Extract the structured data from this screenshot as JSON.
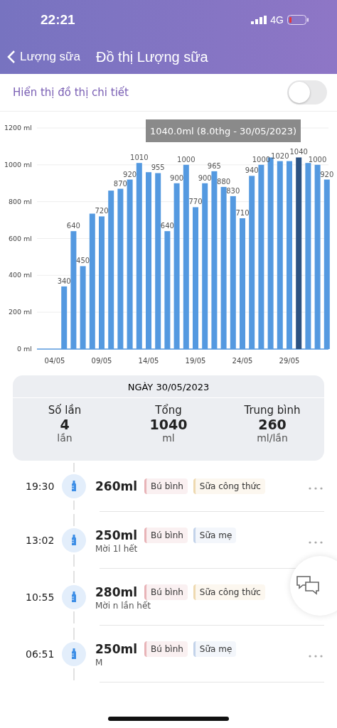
{
  "status_bar": {
    "time": "22:21",
    "network": "4G"
  },
  "header": {
    "back_label": "Lượng sữa",
    "title": "Đồ thị Lượng sữa"
  },
  "detail_toggle": {
    "label": "Hiển thị đồ thị chi tiết",
    "on": false
  },
  "chart_data": {
    "type": "bar",
    "categories": [
      null,
      "04/05",
      null,
      null,
      null,
      null,
      "09/05",
      null,
      null,
      null,
      null,
      "14/05",
      null,
      null,
      null,
      null,
      "19/05",
      null,
      null,
      null,
      null,
      "24/05",
      null,
      null,
      null,
      null,
      "29/05",
      null,
      null,
      null,
      null
    ],
    "stacked": true,
    "series": [
      {
        "color": "#5499e0",
        "values": [
          0,
          0,
          340,
          640,
          450,
          735,
          720,
          860,
          870,
          920,
          1010,
          960,
          955,
          640,
          900,
          1000,
          770,
          900,
          965,
          880,
          830,
          710,
          940,
          1000,
          1040,
          1020,
          1020,
          null,
          1010,
          1000,
          920
        ]
      },
      {
        "color": "#2c5282",
        "values": [
          null,
          null,
          null,
          null,
          null,
          null,
          null,
          null,
          null,
          null,
          null,
          null,
          null,
          null,
          null,
          null,
          null,
          null,
          null,
          null,
          null,
          null,
          null,
          null,
          null,
          null,
          null,
          1040,
          null,
          null,
          null
        ]
      }
    ],
    "ylim": [
      0,
      1200
    ],
    "yticks": [
      {
        "value": 0,
        "label": "0 ml"
      },
      {
        "value": 200,
        "label": "200 ml"
      },
      {
        "value": 400,
        "label": "400 ml"
      },
      {
        "value": 600,
        "label": "600 ml"
      },
      {
        "value": 800,
        "label": "800 ml"
      },
      {
        "value": 1000,
        "label": "1000 ml"
      },
      {
        "value": 1200,
        "label": "1200 ml"
      }
    ],
    "grid": true,
    "value_labels": [
      null,
      null,
      "340",
      "640",
      "450",
      null,
      "720",
      null,
      "870",
      "920",
      "1010",
      null,
      "955",
      "640",
      "900",
      "1000",
      "770",
      "900",
      "965",
      "880",
      "830",
      "710",
      "940",
      "1000",
      null,
      "1020",
      null,
      "1040",
      null,
      "1000",
      "920"
    ],
    "annotations": [
      "1040.0ml (8.0thg - 30/05/2023)"
    ]
  },
  "summary": {
    "date": "NGÀY 30/05/2023",
    "stats": [
      {
        "label": "Số lần",
        "value": "4",
        "unit": "lần"
      },
      {
        "label": "Tổng",
        "value": "1040",
        "unit": "ml"
      },
      {
        "label": "Trung bình",
        "value": "260",
        "unit": "ml/lần"
      }
    ]
  },
  "entries": [
    {
      "time": "19:30",
      "more_button": true,
      "amount": "260ml",
      "tags": [
        {
          "text": "Bú bình",
          "color": "#e8b4b8"
        },
        {
          "text": "Sữa công thức",
          "color": "#eed9b0"
        }
      ]
    },
    {
      "time": "13:02",
      "more_button": true,
      "amount": "250ml",
      "tags": [
        {
          "text": "Bú bình",
          "color": "#e8b4b8"
        },
        {
          "text": "Sữa mẹ",
          "color": "#c3d3ea"
        }
      ],
      "note": "Mời 1l hết"
    },
    {
      "time": "10:55",
      "more_button": false,
      "amount": "280ml",
      "tags": [
        {
          "text": "Bú bình",
          "color": "#e8b4b8"
        },
        {
          "text": "Sữa công thức",
          "color": "#eed9b0"
        }
      ],
      "note": "Mời n lần hết"
    },
    {
      "time": "06:51",
      "more_button": true,
      "amount": "250ml",
      "tags": [
        {
          "text": "Bú bình",
          "color": "#e8b4b8"
        },
        {
          "text": "Sữa mẹ",
          "color": "#c3d3ea"
        }
      ],
      "note": "M"
    }
  ]
}
